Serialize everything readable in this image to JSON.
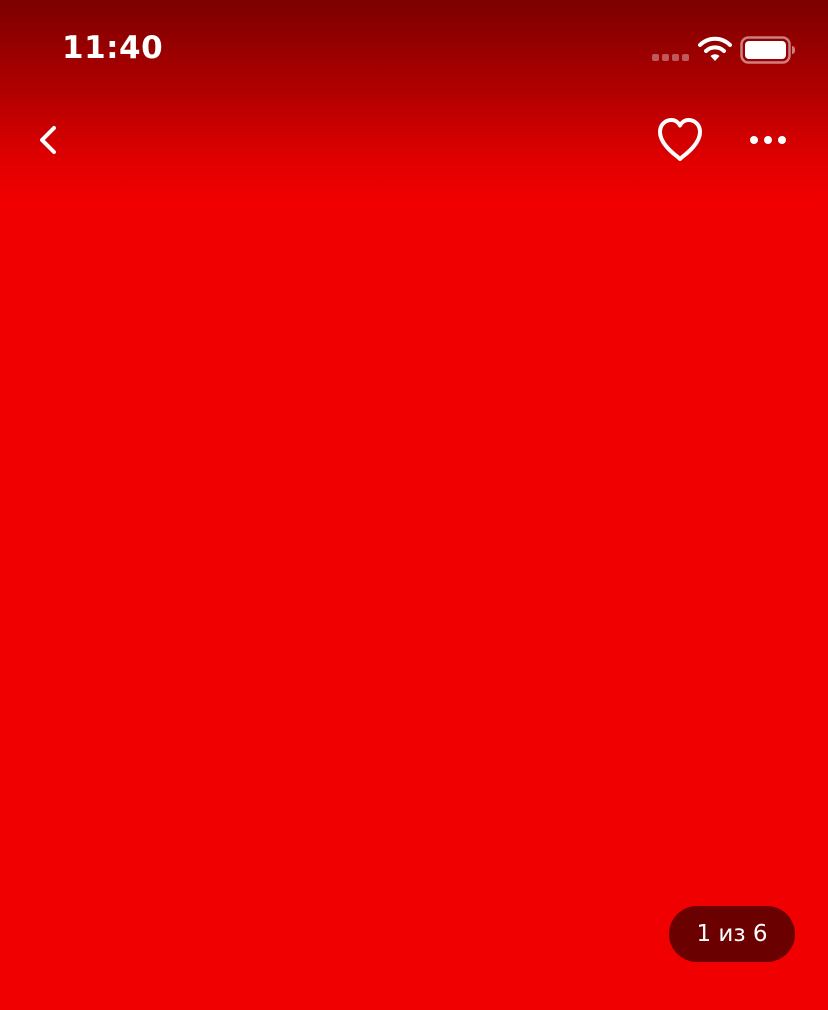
{
  "status_bar": {
    "time": "11:40",
    "signal_icon": "cellular-signal-icon",
    "wifi_icon": "wifi-icon",
    "battery_icon": "battery-icon"
  },
  "nav_bar": {
    "back_icon": "chevron-left-icon",
    "favorite_icon": "heart-outline-icon",
    "more_icon": "more-horizontal-icon"
  },
  "gallery": {
    "page_counter": "1 из 6",
    "current_page": 1,
    "total_pages": 6
  },
  "colors": {
    "background": "#f00000",
    "status_gradient_top": "#7c0000",
    "counter_background": "#6b0000",
    "icon_color": "#ffffff"
  }
}
